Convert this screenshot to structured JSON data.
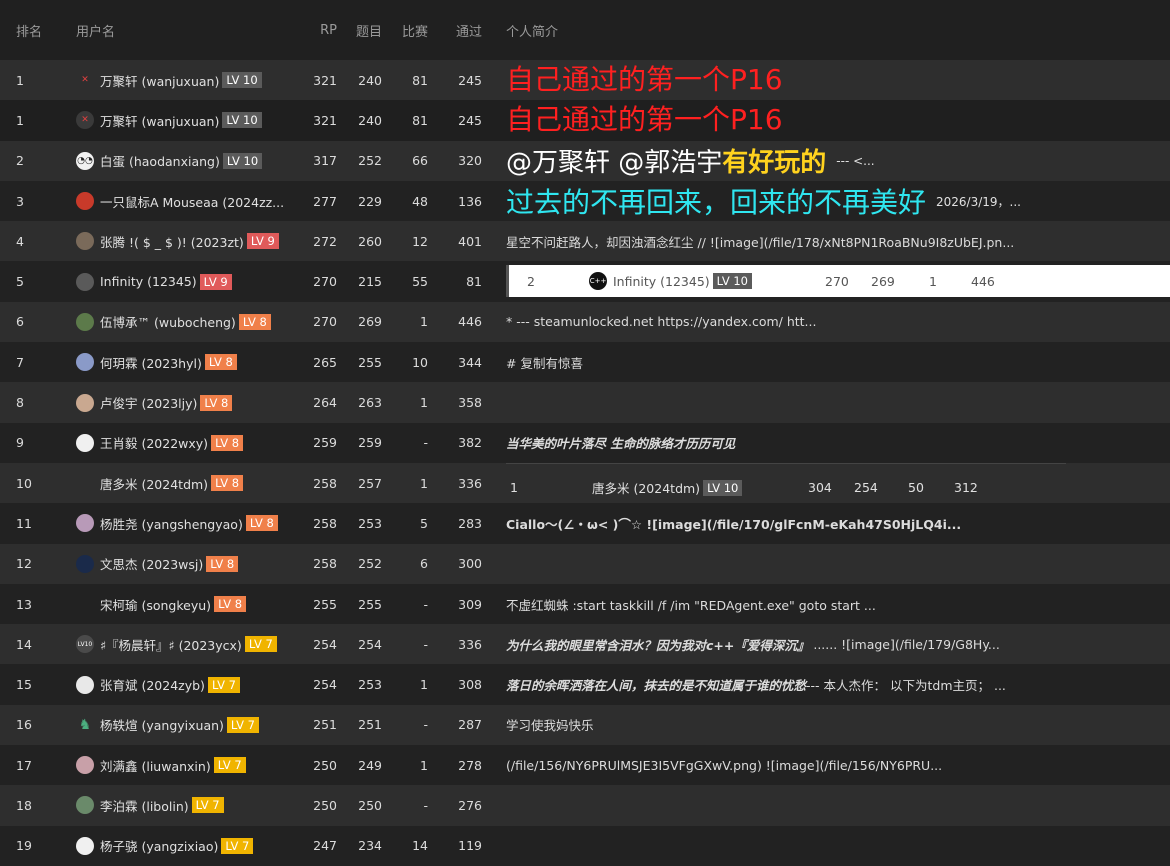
{
  "headers": {
    "rank": "排名",
    "user": "用户名",
    "rp": "RP",
    "problems": "题目",
    "contests": "比赛",
    "passed": "通过",
    "bio": "个人简介"
  },
  "rows": [
    {
      "rank": "1",
      "user": "万聚轩 (wanjuxuan)",
      "badge": "LV 10",
      "rp": "321",
      "problems": "240",
      "contests": "81",
      "passed": "245",
      "bio": "自己通过的第一个P16"
    },
    {
      "rank": "1",
      "user": "万聚轩 (wanjuxuan)",
      "badge": "LV 10",
      "rp": "321",
      "problems": "240",
      "contests": "81",
      "passed": "245",
      "bio": "自己通过的第一个P16"
    },
    {
      "rank": "2",
      "user": "白蛋 (haodanxiang)",
      "badge": "LV 10",
      "rp": "317",
      "problems": "252",
      "contests": "66",
      "passed": "320",
      "bio_a": "@万聚轩 @郭浩宇 ",
      "bio_b": "有好玩的",
      "bio_c": "--- <..."
    },
    {
      "rank": "3",
      "user": "一只鼠标A Mouseaa (2024zz...",
      "badge": "",
      "rp": "277",
      "problems": "229",
      "contests": "48",
      "passed": "136",
      "bio": "过去的不再回来，回来的不再美好",
      "bio_small": "2026/3/19，..."
    },
    {
      "rank": "4",
      "user": "张腾 !( $ _ $ )! (2023zt)",
      "badge": "LV 9",
      "rp": "272",
      "problems": "260",
      "contests": "12",
      "passed": "401",
      "bio": "星空不问赶路人，却因浊酒念红尘 // ![image](/file/178/xNt8PN1RoaBNu9I8zUbEJ.pn..."
    },
    {
      "rank": "5",
      "user": "Infinity (12345)",
      "badge": "LV 9",
      "rp": "270",
      "problems": "215",
      "contests": "55",
      "passed": "81",
      "embed": {
        "rank": "2",
        "user": "Infinity (12345)",
        "badge": "LV 10",
        "rp": "270",
        "problems": "269",
        "contests": "1",
        "passed": "446"
      }
    },
    {
      "rank": "6",
      "user": "伍博承™ (wubocheng)",
      "badge": "LV 8",
      "rp": "270",
      "problems": "269",
      "contests": "1",
      "passed": "446",
      "bio": "* --- steamunlocked.net https://yandex.com/ htt..."
    },
    {
      "rank": "7",
      "user": "何玥霖 (2023hyl)",
      "badge": "LV 8",
      "rp": "265",
      "problems": "255",
      "contests": "10",
      "passed": "344",
      "bio": "# 复制有惊喜"
    },
    {
      "rank": "8",
      "user": "卢俊宇 (2023ljy)",
      "badge": "LV 8",
      "rp": "264",
      "problems": "263",
      "contests": "1",
      "passed": "358",
      "bio": ""
    },
    {
      "rank": "9",
      "user": "王肖毅 (2022wxy)",
      "badge": "LV 8",
      "rp": "259",
      "problems": "259",
      "contests": "-",
      "passed": "382",
      "bio": "当华美的叶片落尽 生命的脉络才历历可见"
    },
    {
      "rank": "10",
      "user": "唐多米 (2024tdm)",
      "badge": "LV 8",
      "rp": "258",
      "problems": "257",
      "contests": "1",
      "passed": "336",
      "embed": {
        "rank": "1",
        "user": "唐多米 (2024tdm)",
        "badge": "LV 10",
        "rp": "304",
        "problems": "254",
        "contests": "50",
        "passed": "312"
      }
    },
    {
      "rank": "11",
      "user": "杨胜尧 (yangshengyao)",
      "badge": "LV 8",
      "rp": "258",
      "problems": "253",
      "contests": "5",
      "passed": "283",
      "bio": "Ciallo～(∠・ω< )⌒☆ ![image](/file/170/glFcnM-eKah47S0HjLQ4i..."
    },
    {
      "rank": "12",
      "user": "文思杰 (2023wsj)",
      "badge": "LV 8",
      "rp": "258",
      "problems": "252",
      "contests": "6",
      "passed": "300",
      "bio": ""
    },
    {
      "rank": "13",
      "user": "宋柯瑜 (songkeyu)",
      "badge": "LV 8",
      "rp": "255",
      "problems": "255",
      "contests": "-",
      "passed": "309",
      "bio": "不虚红蜘蛛 :start taskkill /f /im \"REDAgent.exe\" goto start ..."
    },
    {
      "rank": "14",
      "user": "♯『杨晨轩』♯ (2023ycx)",
      "badge": "LV 7",
      "rp": "254",
      "problems": "254",
      "contests": "-",
      "passed": "336",
      "bio_a": "为什么我的眼里常含泪水？因为我对c++『爱得深沉』",
      "bio_c": "...... ![image](/file/179/G8Hy..."
    },
    {
      "rank": "15",
      "user": "张育斌 (2024zyb)",
      "badge": "LV 7",
      "rp": "254",
      "problems": "253",
      "contests": "1",
      "passed": "308",
      "bio_a": "落日的余晖洒落在人间，抹去的是不知道属于谁的忧愁",
      "bio_c": " --- 本人杰作： 以下为tdm主页； ..."
    },
    {
      "rank": "16",
      "user": "杨轶煊 (yangyixuan)",
      "badge": "LV 7",
      "rp": "251",
      "problems": "251",
      "contests": "-",
      "passed": "287",
      "bio": "学习使我妈快乐"
    },
    {
      "rank": "17",
      "user": "刘满鑫 (liuwanxin)",
      "badge": "LV 7",
      "rp": "250",
      "problems": "249",
      "contests": "1",
      "passed": "278",
      "bio": "(/file/156/NY6PRUlMSJE3I5VFgGXwV.png) ![image](/file/156/NY6PRU..."
    },
    {
      "rank": "18",
      "user": "李泊霖 (libolin)",
      "badge": "LV 7",
      "rp": "250",
      "problems": "250",
      "contests": "-",
      "passed": "276",
      "bio": ""
    },
    {
      "rank": "19",
      "user": "杨子骁 (yangzixiao)",
      "badge": "LV 7",
      "rp": "247",
      "problems": "234",
      "contests": "14",
      "passed": "119",
      "bio": ""
    }
  ],
  "avatar_glyphs": {
    "x": "✕",
    "v10": "LV10",
    "cpp": "C++"
  },
  "colors": {
    "lv10": "#5b5b5b",
    "lv9": "#e05a5a",
    "lv8": "#f0804a",
    "lv7": "#f0b400",
    "red_text": "#ff2020",
    "cyan_text": "#2fe6f0",
    "yellow_text": "#ffd21e"
  }
}
